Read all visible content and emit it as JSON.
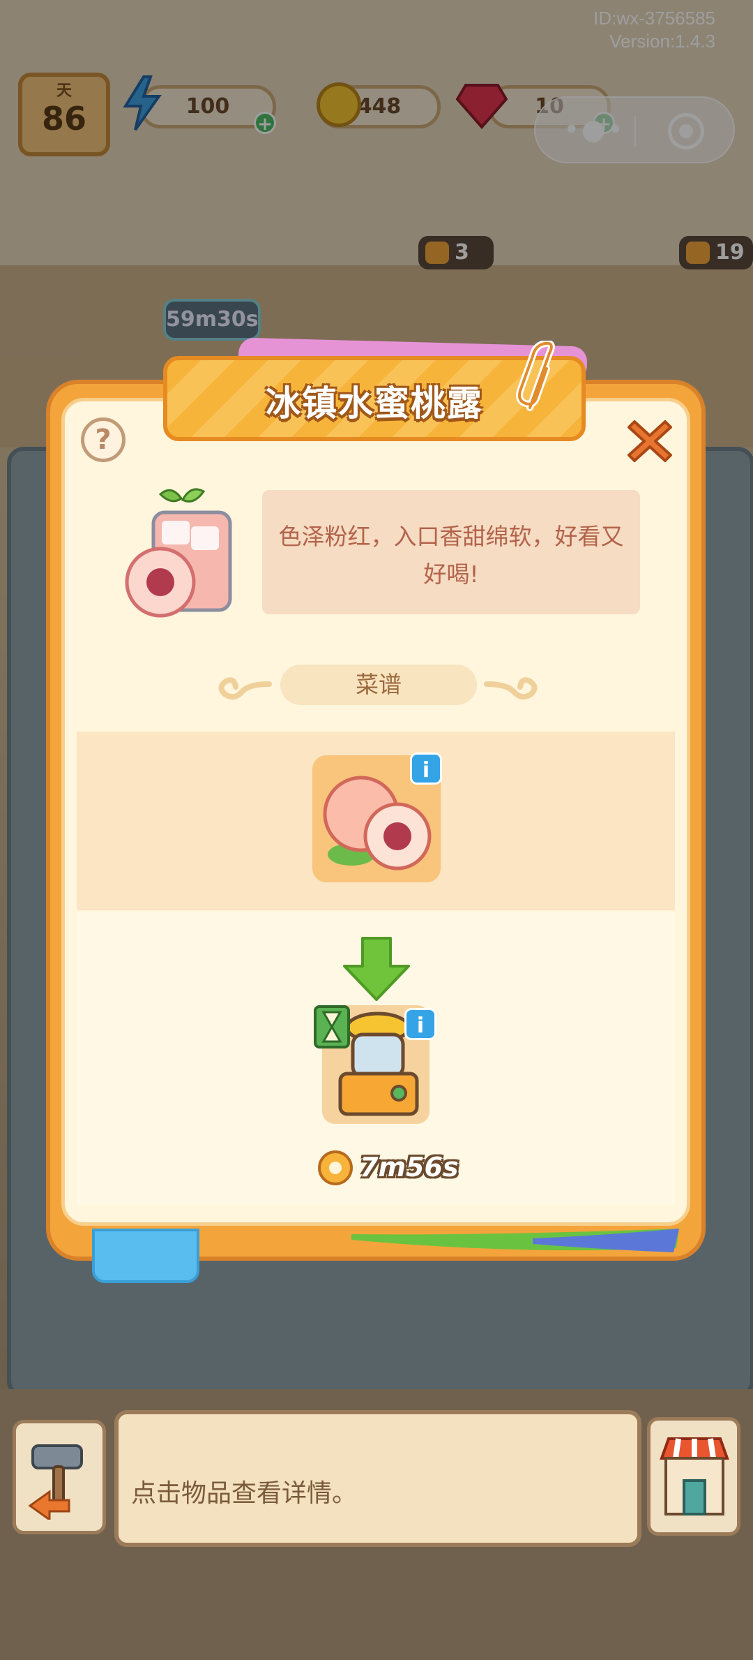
{
  "header": {
    "app_id": "ID:wx-3756585",
    "version": "Version:1.4.3",
    "day_label": "天",
    "day_value": "86",
    "energy": "100",
    "coins": "448",
    "gems": "10"
  },
  "scene": {
    "timer_tag": "59m30s",
    "order_count_1": "3",
    "order_count_2": "19"
  },
  "dialog": {
    "title": "冰镇水蜜桃露",
    "description": "色泽粉红，入口香甜绵软，好看又好喝!",
    "recipe_label": "菜谱",
    "info_symbol": "i",
    "help_symbol": "?",
    "cook_time": "7m56s"
  },
  "bottom": {
    "hint": "点击物品查看详情。"
  },
  "colors": {
    "dialog_orange": "#f3a43b",
    "panel_cream": "#fff6dd",
    "ingredient_band": "#fbe5c2",
    "description_text": "#b3634a",
    "arrow_green": "#6fc43b",
    "info_blue": "#35a4e6"
  },
  "icons": [
    "help-icon",
    "close-icon",
    "peach-drink-icon",
    "peach-icon",
    "arrow-down-icon",
    "juicer-machine-icon",
    "hourglass-icon",
    "clock-icon",
    "paperclip-icon",
    "hammer-icon",
    "shop-icon",
    "energy-icon",
    "coin-icon",
    "gem-icon"
  ]
}
